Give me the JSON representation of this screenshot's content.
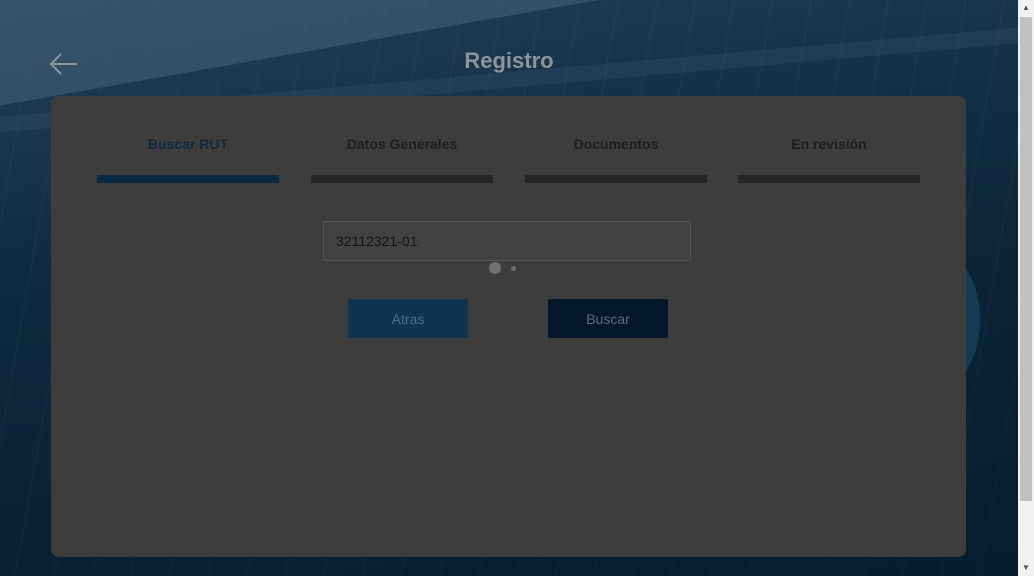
{
  "header": {
    "title": "Registro",
    "back_icon": "arrow-left-icon"
  },
  "steps": [
    {
      "label": "Buscar RUT",
      "active": true
    },
    {
      "label": "Datos Generales",
      "active": false
    },
    {
      "label": "Documentos",
      "active": false
    },
    {
      "label": "En revisión",
      "active": false
    }
  ],
  "form": {
    "rut_value": "32112321-01"
  },
  "buttons": {
    "back_label": "Atras",
    "search_label": "Buscar"
  },
  "colors": {
    "active_step": "#0b2a45",
    "inactive_step": "#262626",
    "back_button": "#0f3452",
    "search_button": "#04182b"
  }
}
